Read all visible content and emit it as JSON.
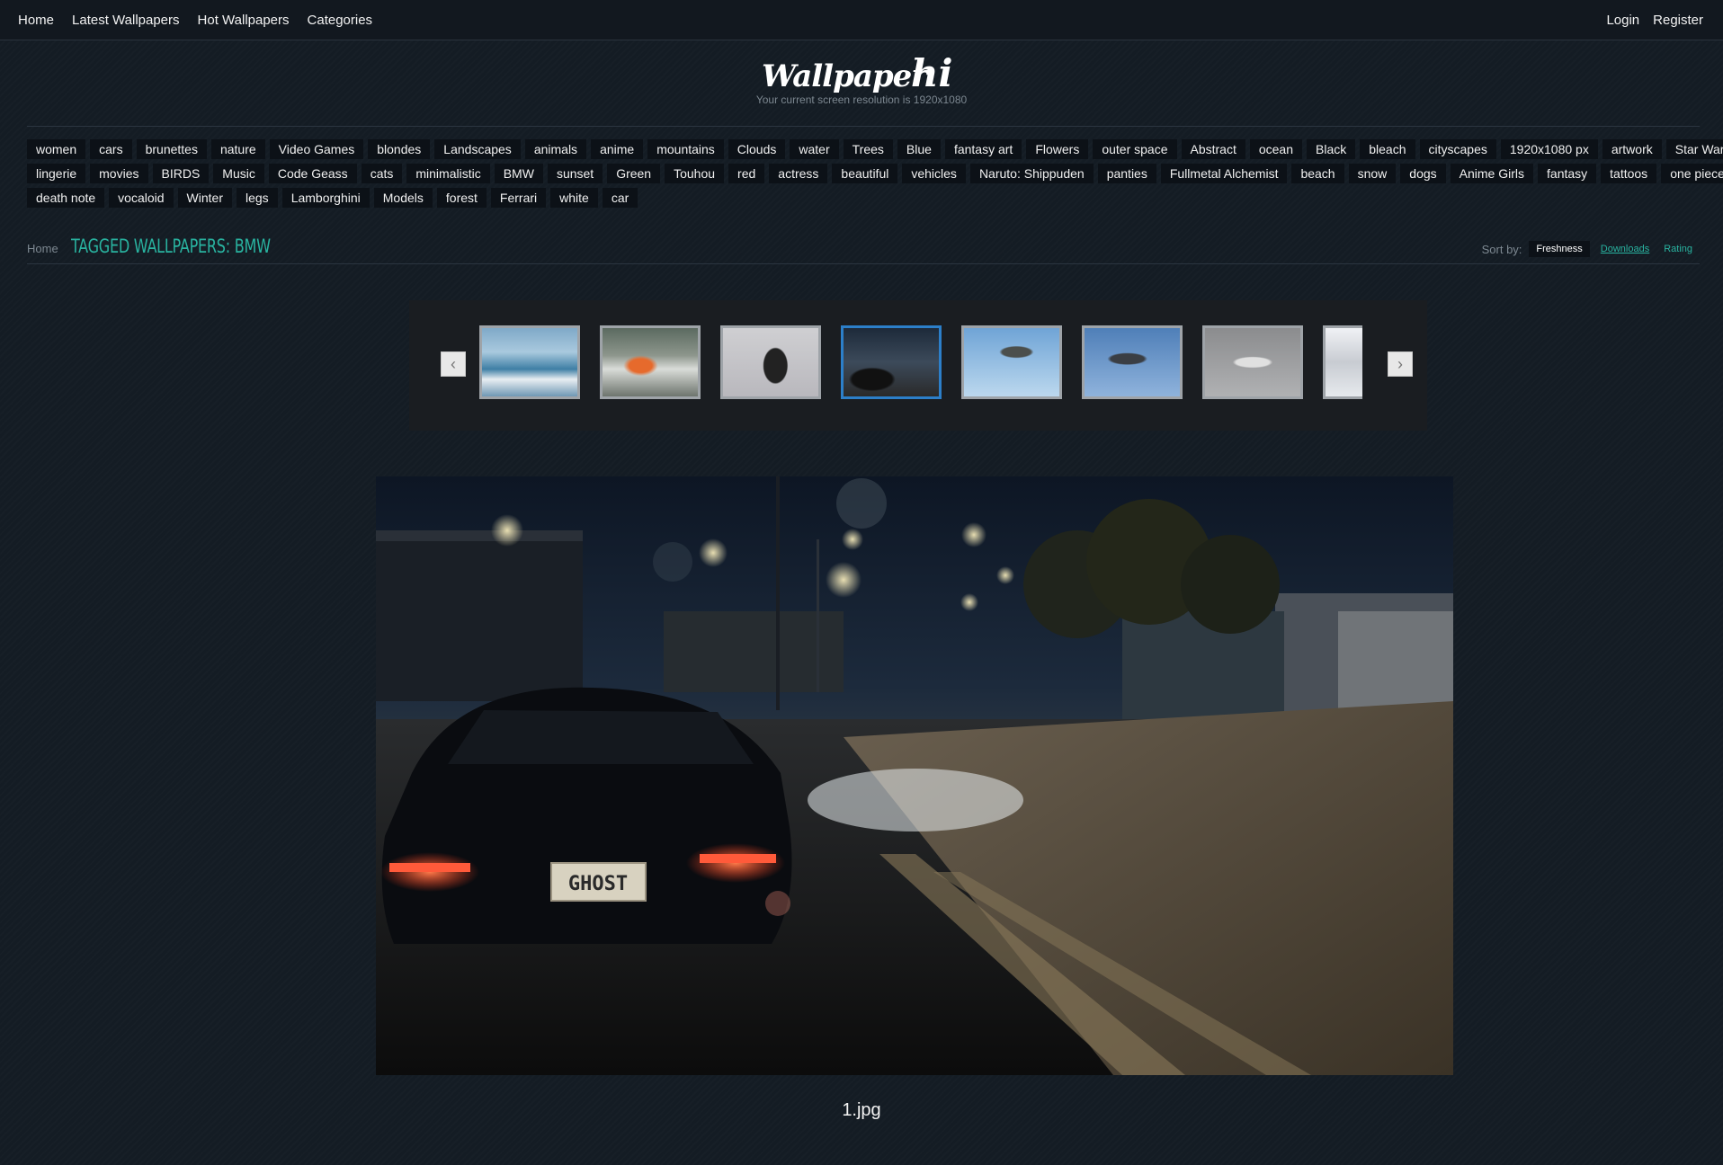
{
  "topnav": {
    "home": "Home",
    "latest": "Latest Wallpapers",
    "hot": "Hot Wallpapers",
    "categories": "Categories",
    "login": "Login",
    "register": "Register"
  },
  "header": {
    "logo_text": "Wallpaperhi",
    "resolution": "Your current screen resolution is 1920x1080"
  },
  "tags": {
    "row1": [
      "women",
      "cars",
      "brunettes",
      "nature",
      "Video Games",
      "blondes",
      "Landscapes",
      "animals",
      "anime",
      "mountains",
      "Clouds",
      "water",
      "Trees",
      "Blue",
      "fantasy art",
      "Flowers",
      "outer space",
      "Abstract",
      "ocean",
      "Black",
      "bleach",
      "cityscapes",
      "1920x1080 px",
      "artwork",
      "Star Wars"
    ],
    "row2": [
      "lingerie",
      "movies",
      "BIRDS",
      "Music",
      "Code Geass",
      "cats",
      "minimalistic",
      "BMW",
      "sunset",
      "Green",
      "Touhou",
      "red",
      "actress",
      "beautiful",
      "vehicles",
      "Naruto: Shippuden",
      "panties",
      "Fullmetal Alchemist",
      "beach",
      "snow",
      "dogs",
      "Anime Girls",
      "fantasy",
      "tattoos",
      "one piece"
    ],
    "row3": [
      "death note",
      "vocaloid",
      "Winter",
      "legs",
      "Lamborghini",
      "Models",
      "forest",
      "Ferrari",
      "white",
      "car"
    ]
  },
  "breadcrumb": {
    "home": "Home",
    "title": "TAGGED WALLPAPERS: BMW"
  },
  "sort": {
    "label": "Sort by:",
    "freshness": "Freshness",
    "downloads": "Downloads",
    "rating": "Rating"
  },
  "carousel": {
    "prev_icon": "chevron-left-icon",
    "next_icon": "chevron-right-icon",
    "thumbnails": [
      {
        "name": "thumb-1",
        "active": false
      },
      {
        "name": "thumb-2",
        "active": false
      },
      {
        "name": "thumb-3",
        "active": false
      },
      {
        "name": "thumb-4",
        "active": true
      },
      {
        "name": "thumb-5",
        "active": false
      },
      {
        "name": "thumb-6",
        "active": false
      },
      {
        "name": "thumb-7",
        "active": false
      },
      {
        "name": "thumb-8",
        "active": false
      }
    ]
  },
  "main": {
    "filename": "1.jpg",
    "plate": "GHOST"
  },
  "colors": {
    "accent": "#29b3a0",
    "active_border": "#2c7fc9",
    "background": "#141c24"
  }
}
